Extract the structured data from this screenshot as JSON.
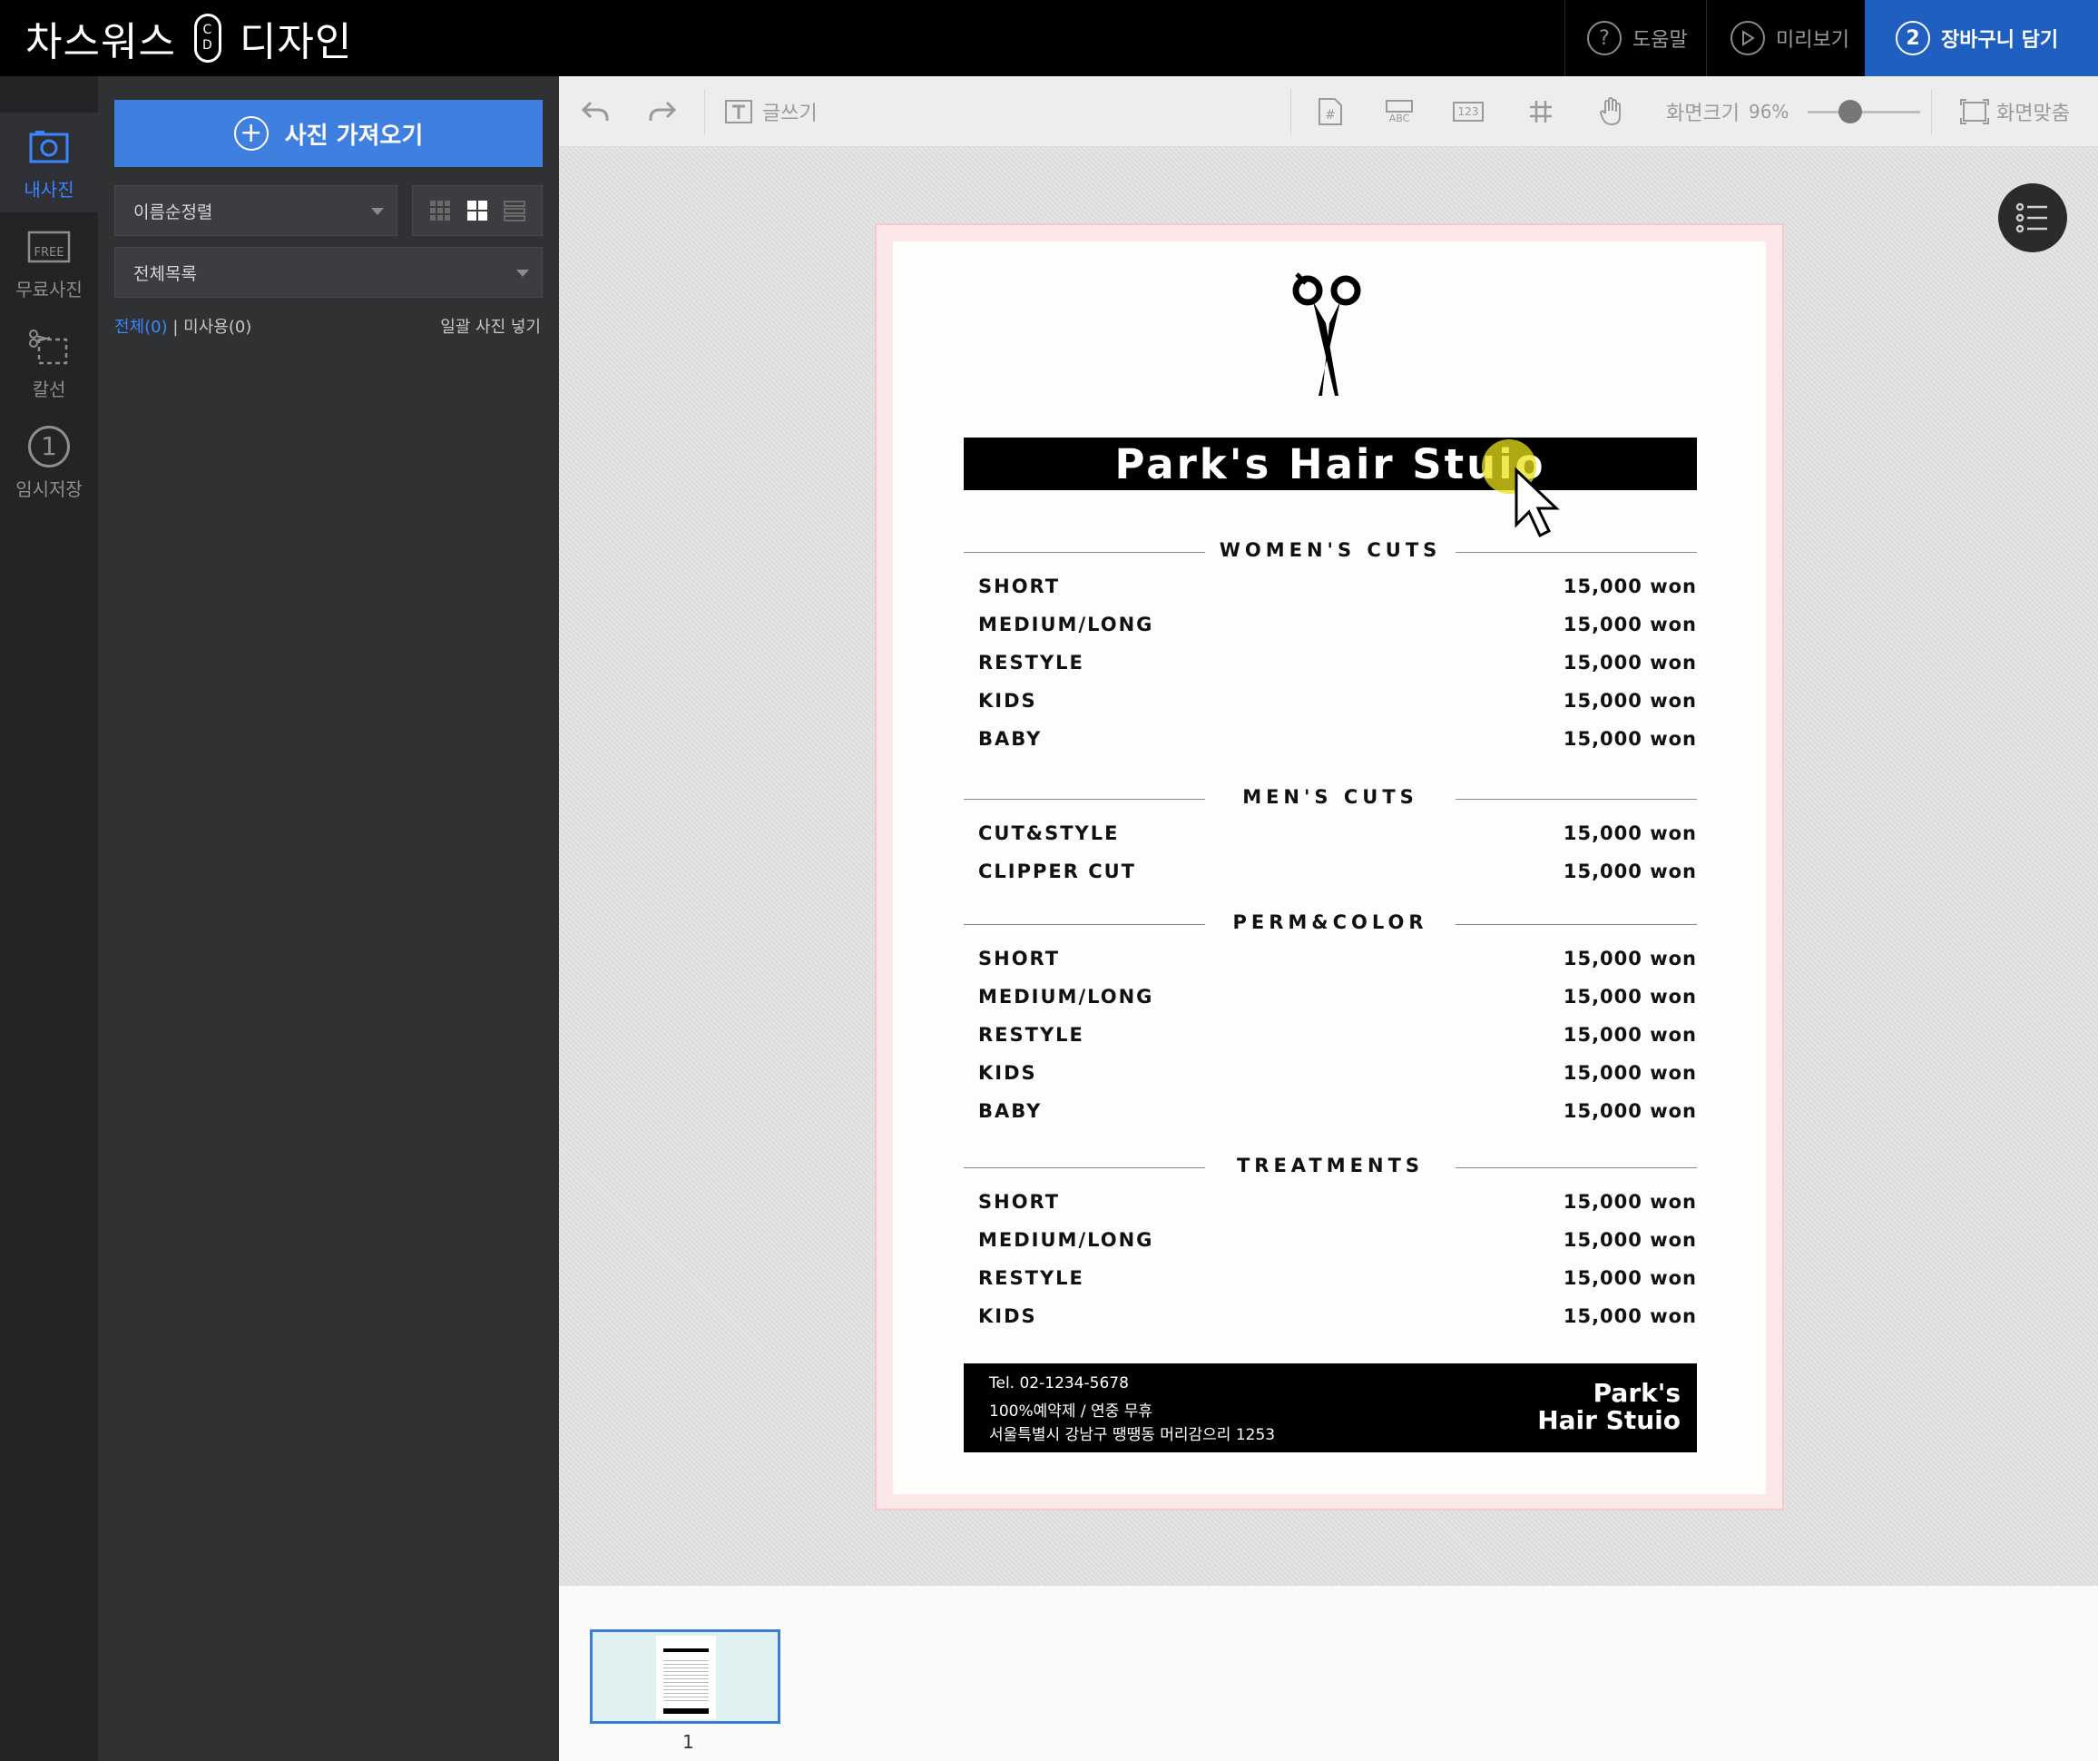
{
  "app": {
    "brand_left": "차스워스",
    "brand_logo_top": "C",
    "brand_logo_bottom": "D",
    "brand_right": "디자인"
  },
  "topbar": {
    "help": {
      "num": "?",
      "label": "도움말"
    },
    "preview": {
      "label": "미리보기"
    },
    "cart": {
      "num": "2",
      "label": "장바구니 담기"
    }
  },
  "rail": {
    "items": [
      {
        "label": "내사진"
      },
      {
        "label": "무료사진"
      },
      {
        "label": "칼선"
      },
      {
        "num": "1",
        "label": "임시저장"
      }
    ]
  },
  "panel": {
    "import_label": "사진 가져오기",
    "sort_value": "이름순정렬",
    "album_value": "전체목록",
    "count_all": "전체(0)",
    "count_sep": " | ",
    "count_unused": "미사용(0)",
    "batch_label": "일괄 사진 넣기"
  },
  "toolbar": {
    "text_label": "글쓰기",
    "zoom_label": "화면크기",
    "zoom_value": "96%",
    "fit_label": "화면맞춤",
    "abc": "ABC",
    "num": "123"
  },
  "document": {
    "title": "Park's Hair Stuio",
    "sections": [
      {
        "heading": "WOMEN'S CUTS",
        "items": [
          {
            "name": "SHORT",
            "price": "15,000 won"
          },
          {
            "name": "MEDIUM/LONG",
            "price": "15,000 won"
          },
          {
            "name": "RESTYLE",
            "price": "15,000 won"
          },
          {
            "name": "KIDS",
            "price": "15,000 won"
          },
          {
            "name": "BABY",
            "price": "15,000 won"
          }
        ]
      },
      {
        "heading": "MEN'S CUTS",
        "items": [
          {
            "name": "CUT&STYLE",
            "price": "15,000 won"
          },
          {
            "name": "CLIPPER CUT",
            "price": "15,000 won"
          }
        ]
      },
      {
        "heading": "PERM&COLOR",
        "items": [
          {
            "name": "SHORT",
            "price": "15,000 won"
          },
          {
            "name": "MEDIUM/LONG",
            "price": "15,000 won"
          },
          {
            "name": "RESTYLE",
            "price": "15,000 won"
          },
          {
            "name": "KIDS",
            "price": "15,000 won"
          },
          {
            "name": "BABY",
            "price": "15,000 won"
          }
        ]
      },
      {
        "heading": "TREATMENTS",
        "items": [
          {
            "name": "SHORT",
            "price": "15,000 won"
          },
          {
            "name": "MEDIUM/LONG",
            "price": "15,000 won"
          },
          {
            "name": "RESTYLE",
            "price": "15,000 won"
          },
          {
            "name": "KIDS",
            "price": "15,000 won"
          }
        ]
      }
    ],
    "footer": {
      "tel": "Tel. 02-1234-5678",
      "hours": "100%예약제 / 연중 무휴",
      "address": "서울특별시 강남구 땡땡동 머리감으리 1253",
      "brand_line1": "Park's",
      "brand_line2": "Hair Stuio"
    }
  },
  "pages": {
    "current": "1"
  },
  "colors": {
    "accent": "#3e7fdf",
    "cart": "#1f5fbf",
    "active_rail": "#3b86ff"
  }
}
